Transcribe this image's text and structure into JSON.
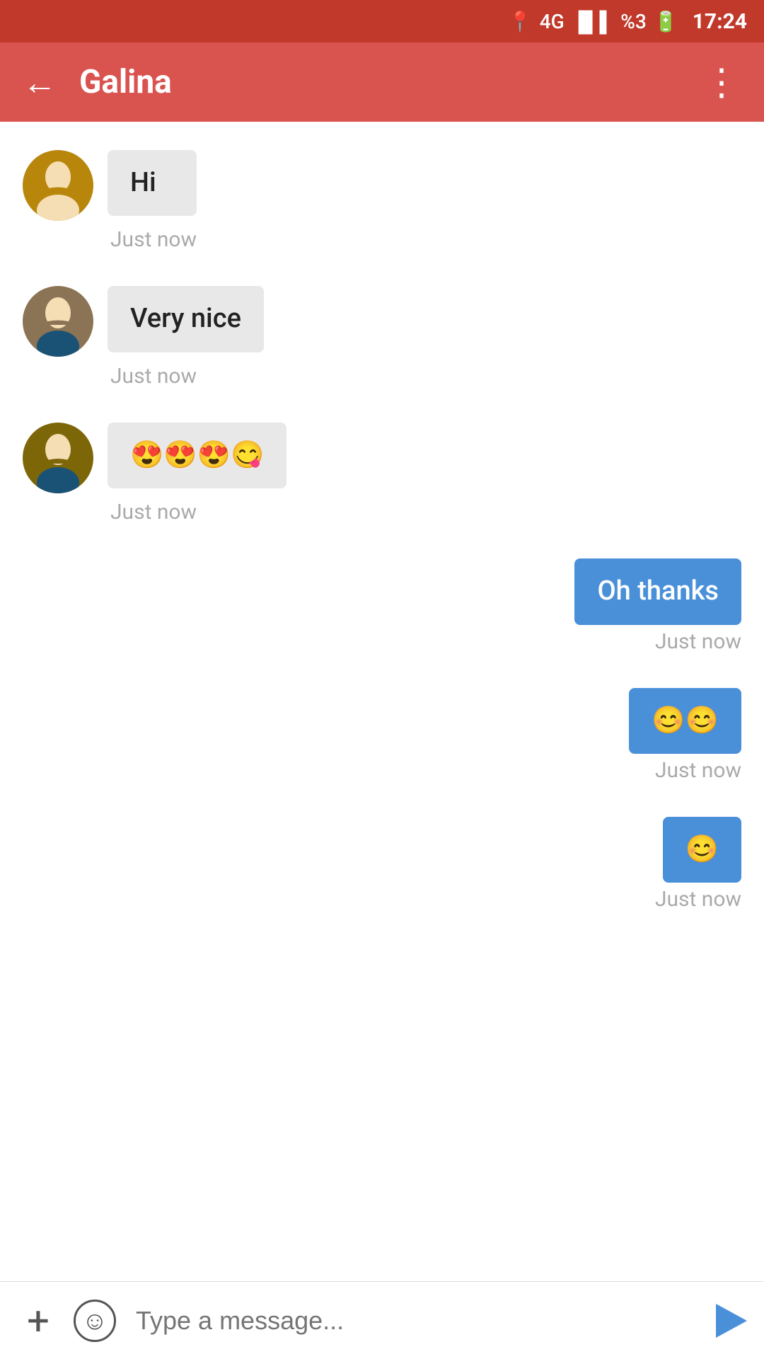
{
  "statusBar": {
    "time": "17:24",
    "battery": "%3"
  },
  "appBar": {
    "title": "Galina",
    "backLabel": "←",
    "moreLabel": "⋮"
  },
  "messages": [
    {
      "id": "msg1",
      "type": "received",
      "text": "Hi",
      "timestamp": "Just now",
      "hasAvatar": true
    },
    {
      "id": "msg2",
      "type": "received",
      "text": "Very nice",
      "timestamp": "Just now",
      "hasAvatar": true
    },
    {
      "id": "msg3",
      "type": "received",
      "text": "😍😍😍😋",
      "timestamp": "Just now",
      "hasAvatar": true
    },
    {
      "id": "msg4",
      "type": "sent",
      "text": "Oh thanks",
      "timestamp": "Just now",
      "hasAvatar": false
    },
    {
      "id": "msg5",
      "type": "sent",
      "text": "😊😊",
      "timestamp": "Just now",
      "hasAvatar": false
    },
    {
      "id": "msg6",
      "type": "sent",
      "text": "😊",
      "timestamp": "Just now",
      "hasAvatar": false
    }
  ],
  "bottomBar": {
    "placeholder": "Type a message...",
    "addLabel": "+",
    "emojiLabel": "☺"
  }
}
